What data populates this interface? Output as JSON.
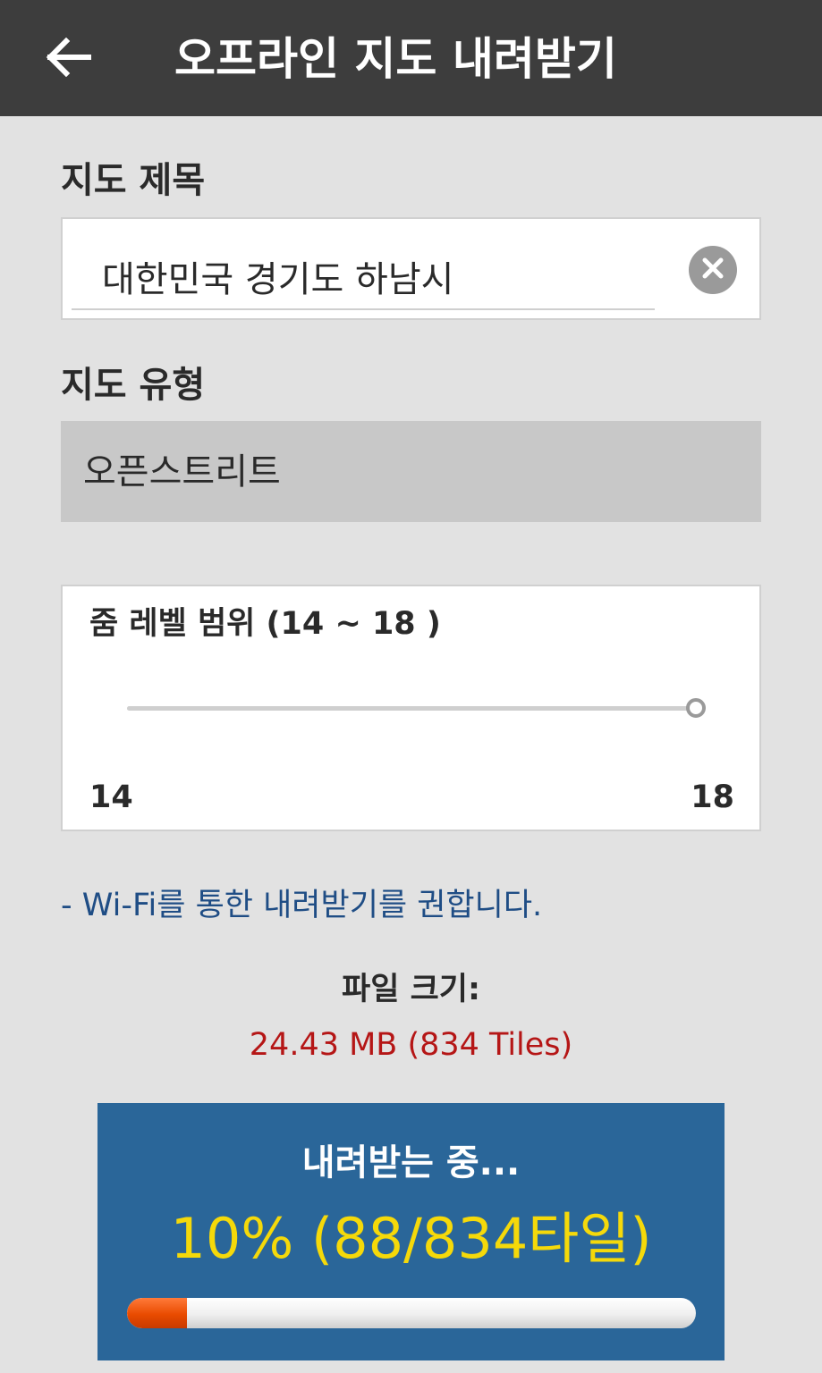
{
  "appbar": {
    "title": "오프라인 지도 내려받기",
    "back_icon": "arrow-left-icon"
  },
  "map_title": {
    "label": "지도 제목",
    "value": "대한민국 경기도 하남시",
    "clear_icon": "clear-circle-icon"
  },
  "map_type": {
    "label": "지도 유형",
    "value": "오픈스트리트"
  },
  "zoom": {
    "title": "줌 레벨 범위 (14 ~ 18 )",
    "min_label": "14",
    "max_label": "18",
    "range_min": 14,
    "range_max": 18,
    "selected_high": 18
  },
  "note": "- Wi-Fi를 통한 내려받기를 권합니다.",
  "file_size": {
    "label": "파일 크기:",
    "value": "24.43 MB (834 Tiles)"
  },
  "download": {
    "status": "내려받는 중...",
    "progress_text": "10% (88/834타일)",
    "done_tiles": 88,
    "total_tiles": 834,
    "percent": 10
  },
  "colors": {
    "appbar": "#3d3d3d",
    "background": "#e2e2e2",
    "note": "#1f4d85",
    "file_size_value": "#b51616",
    "progress_panel": "#2a6699",
    "progress_text": "#f5d90a",
    "progress_fill": "#e94b00"
  }
}
